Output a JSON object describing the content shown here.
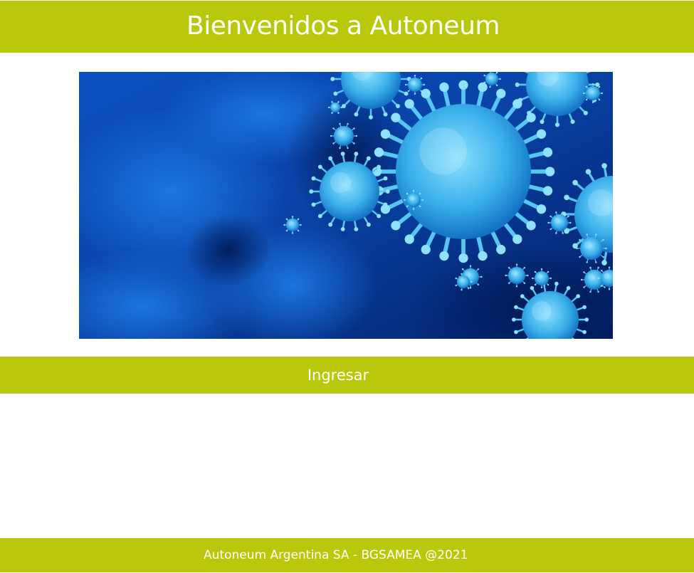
{
  "colors": {
    "brand": "#bac80b",
    "text_on_brand": "#ffffff",
    "hero_deep": "#02256e",
    "hero_mid": "#0a5bcf",
    "virus": "#4fc3f0"
  },
  "header": {
    "title": "Bienvenidos a Autoneum"
  },
  "hero": {
    "icon": "virus-illustration-icon"
  },
  "login": {
    "button_label": "Ingresar"
  },
  "footer": {
    "text": "Autoneum Argentina SA - BGSAMEA @2021"
  }
}
